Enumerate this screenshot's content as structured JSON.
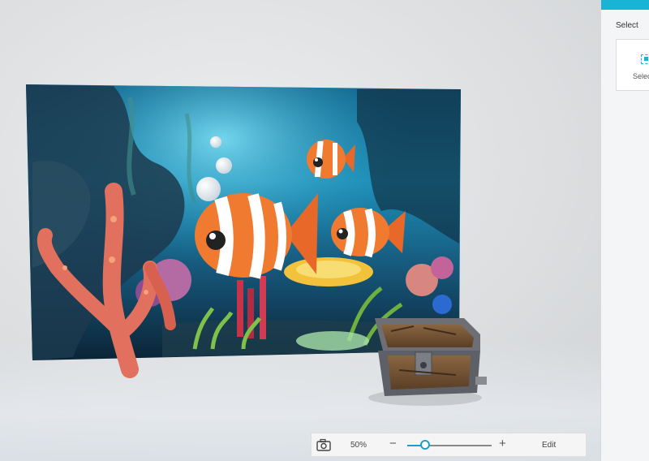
{
  "side_panel": {
    "title": "Select",
    "card_label": "Selec",
    "accent_color": "#19b3d5",
    "card_icon": "select-box-icon"
  },
  "toolbar": {
    "camera_icon": "camera-icon",
    "zoom_value": "50%",
    "zoom_level": 0.5,
    "zoom_out_label": "−",
    "zoom_in_label": "+",
    "edit_label": "Edit"
  },
  "scene": {
    "objects": [
      "underwater-scene-image",
      "clownfish-large",
      "clownfish-top",
      "clownfish-right",
      "bubbles",
      "coral-branch",
      "treasure-chest"
    ]
  }
}
